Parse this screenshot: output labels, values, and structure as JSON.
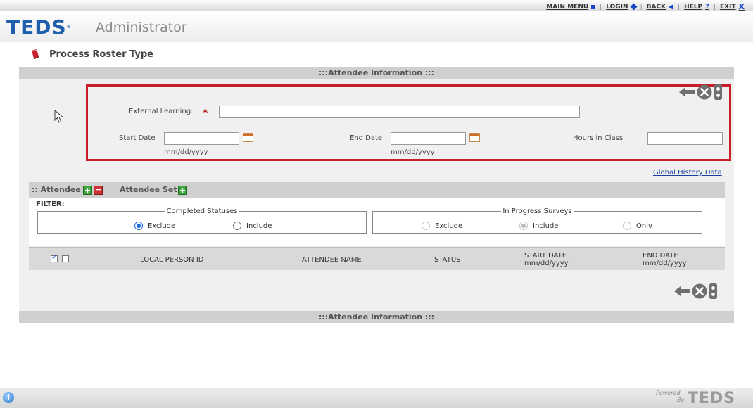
{
  "top_menu": {
    "main_menu": "MAIN MENU",
    "login": "LOGIN",
    "back": "BACK",
    "help": "HELP",
    "help_icon": "?",
    "exit": "EXIT",
    "exit_icon": "X"
  },
  "header": {
    "logo": "TEDS",
    "logo_mark": "®",
    "app_name": "Administrator"
  },
  "page": {
    "title": "Process Roster Type"
  },
  "section": {
    "title": ":::Attendee Information :::"
  },
  "form": {
    "external_learning_label": "External Learning:",
    "required_mark": "*",
    "external_learning_value": "",
    "start_date_label": "Start Date",
    "start_date_value": "",
    "end_date_label": "End Date",
    "end_date_value": "",
    "hours_label": "Hours in Class",
    "hours_value": "",
    "date_format": "mm/dd/yyyy"
  },
  "global_history_link": "Global History Data",
  "attendee_bar": {
    "attendee_label": ":: Attendee",
    "attendee_set_label": "Attendee Set",
    "plus": "+",
    "minus": "−"
  },
  "filter": {
    "label": "FILTER:",
    "completed_statuses": {
      "legend": "Completed Statuses",
      "options": [
        "Exclude",
        "Include"
      ],
      "selected": "Exclude"
    },
    "in_progress_surveys": {
      "legend": "In Progress Surveys",
      "options": [
        "Exclude",
        "Include",
        "Only"
      ],
      "selected": "Include",
      "disabled": true
    }
  },
  "table": {
    "columns": {
      "local_person_id": "LOCAL PERSON ID",
      "attendee_name": "ATTENDEE NAME",
      "status": "STATUS",
      "start_date": "START DATE",
      "end_date": "END DATE",
      "date_format": "mm/dd/yyyy"
    }
  },
  "footer": {
    "info_icon": "i",
    "powered": "Powered",
    "by": "By",
    "brand": "TEDS"
  },
  "colors": {
    "brand_blue": "#1e5fae",
    "highlight_red": "#c81e28",
    "section_gray": "#cfcfcf",
    "link_blue": "#1a3f9e"
  },
  "icons": [
    "book-icon",
    "back-arrow-icon",
    "close-icon",
    "traffic-light-icon",
    "calendar-icon",
    "add-icon",
    "remove-icon",
    "info-icon",
    "cursor-icon"
  ]
}
